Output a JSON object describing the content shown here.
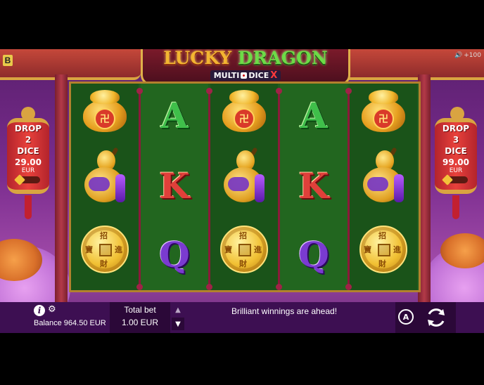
{
  "brand_badge": "B",
  "sound_level": "+100",
  "title": {
    "word1": "LUCKY",
    "word2": "DRAGON",
    "sub_prefix": "MULTI",
    "sub_mid": "DICE",
    "sub_suffix": "X"
  },
  "lanterns": {
    "left": {
      "line1": "DROP",
      "line2": "2",
      "line3": "DICE",
      "amount": "29.00",
      "currency": "EUR"
    },
    "right": {
      "line1": "DROP",
      "line2": "3",
      "line3": "DICE",
      "amount": "99.00",
      "currency": "EUR"
    }
  },
  "reels": [
    [
      "gold-pot",
      "gourd",
      "coin"
    ],
    [
      "A",
      "K",
      "Q"
    ],
    [
      "gold-pot",
      "gourd",
      "coin"
    ],
    [
      "A",
      "K",
      "Q"
    ],
    [
      "gold-pot",
      "gourd",
      "coin"
    ]
  ],
  "symbols": {
    "letter_A": "A",
    "letter_K": "K",
    "letter_Q": "Q",
    "seal_char": "卍",
    "coin_chars": [
      "招",
      "進",
      "寶",
      "財"
    ]
  },
  "bottom_bar": {
    "info_icon": "i",
    "balance_label": "Balance 964.50 EUR",
    "bet_label": "Total bet",
    "bet_value": "1.00 EUR",
    "message": "Brilliant winnings are ahead!",
    "autoplay_label": "A"
  },
  "colors": {
    "bar_bg": "#3d0f52",
    "reel_bg": "#1f5d1f",
    "title_gold": "#f3b531",
    "title_green": "#6ddb47"
  }
}
